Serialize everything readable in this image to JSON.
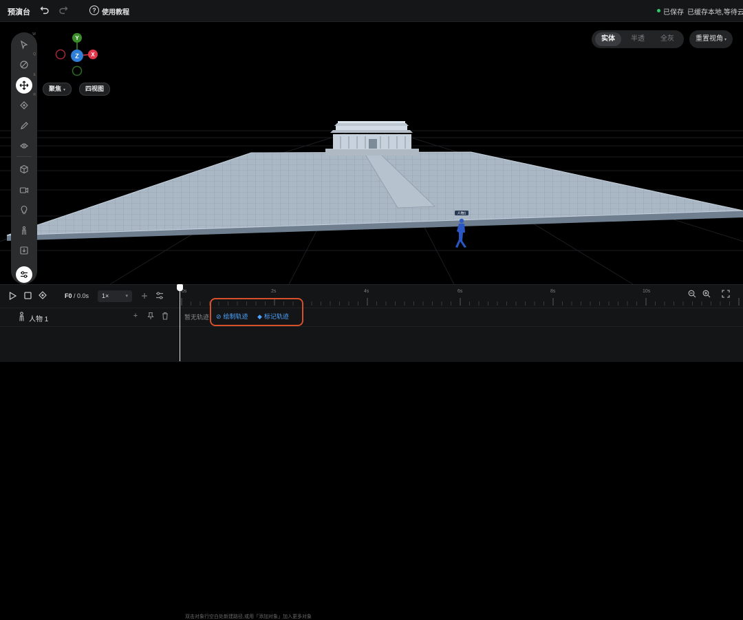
{
  "topbar": {
    "title": "预演台",
    "help_label": "使用教程",
    "save_status": "已保存",
    "cache_status": "已缓存本地,等待云端",
    "help_glyph": "?"
  },
  "viewport": {
    "focus_label": "聚焦",
    "four_view_label": "四视图",
    "modes": [
      "实体",
      "半透",
      "全灰"
    ],
    "active_mode": "实体",
    "reset_view_label": "重置视角",
    "gizmo": {
      "y": "Y",
      "z": "Z",
      "x": "X"
    },
    "character_tag": "人物1"
  },
  "toolbar": {
    "tools": [
      "select-tool",
      "rotate-tool",
      "move-tool",
      "transform-tool",
      "pen-tool",
      "effect-tool",
      "cube-tool",
      "camera-tool",
      "light-tool",
      "character-tool",
      "import-tool",
      "settings-tool"
    ],
    "active_tool": "move-tool",
    "shortcut_hints": [
      "W",
      "Q",
      "E",
      "R"
    ]
  },
  "timeline": {
    "frame_label": "F0",
    "time_label": "/ 0.0s",
    "speed": "1×",
    "ticks": [
      "0s",
      "2s",
      "4s",
      "6s",
      "8s",
      "10s"
    ],
    "track_name": "人物 1",
    "no_track": "暂无轨迹",
    "draw_track": "绘制轨迹",
    "mark_track": "标记轨迹",
    "hint": "双击对象行空白处新建路径,或用「添加对象」加入更多对象"
  },
  "colors": {
    "accent": "#4ea3ff",
    "highlight": "#d7502a",
    "save_dot": "#2ecc71",
    "axis_x": "#e0384a",
    "axis_y": "#3b8c2a",
    "axis_z": "#2f7fd8"
  }
}
